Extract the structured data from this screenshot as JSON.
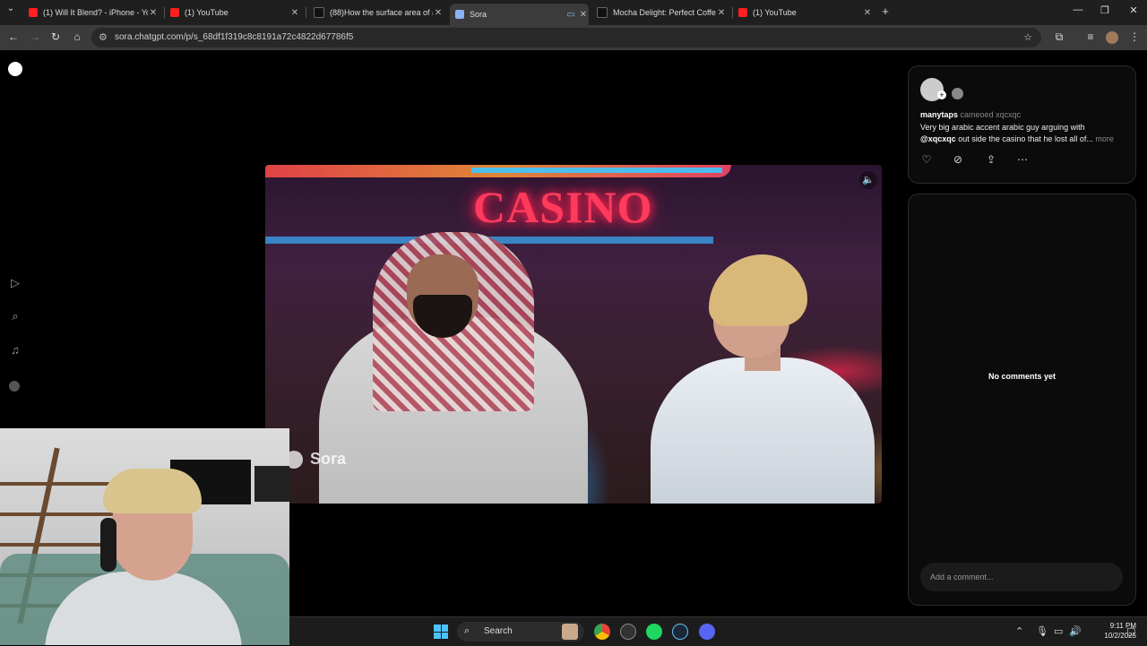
{
  "browser": {
    "tabs": [
      {
        "title": "(1) Will It Blend? - iPhone - You",
        "favicon": "youtube-icon"
      },
      {
        "title": "(1) YouTube",
        "favicon": "youtube-icon"
      },
      {
        "title": "(88)How the surface area of a s",
        "favicon": "tiktok-icon"
      },
      {
        "title": "Sora",
        "favicon": "sora-icon",
        "active": true
      },
      {
        "title": "Mocha Delight: Perfect Coffee",
        "favicon": "tiktok-icon"
      },
      {
        "title": "(1) YouTube",
        "favicon": "youtube-icon"
      }
    ],
    "new_tab": "+",
    "url": "sora.chatgpt.com/p/s_68df1f319c8c8191a72c4822d67786f5",
    "window_controls": {
      "minimize": "—",
      "restore": "❐",
      "close": "✕"
    },
    "nav": {
      "back": "←",
      "forward": "→",
      "reload": "↻",
      "home": "⌂"
    }
  },
  "video": {
    "sign_text": "CASINO",
    "watermark": "Sora"
  },
  "post": {
    "username": "manytaps",
    "action": "cameoed xqcxqc",
    "caption_text": "Very big arabic accent arabic guy arguing with",
    "caption_mention": "@xqcxqc",
    "caption_rest": " out side the casino that he lost all of...",
    "more": "more"
  },
  "comments": {
    "empty_text": "No comments yet",
    "input_placeholder": "Add a comment..."
  },
  "taskbar": {
    "search": "Search",
    "time": "9:11 PM",
    "date": "10/2/2025"
  }
}
